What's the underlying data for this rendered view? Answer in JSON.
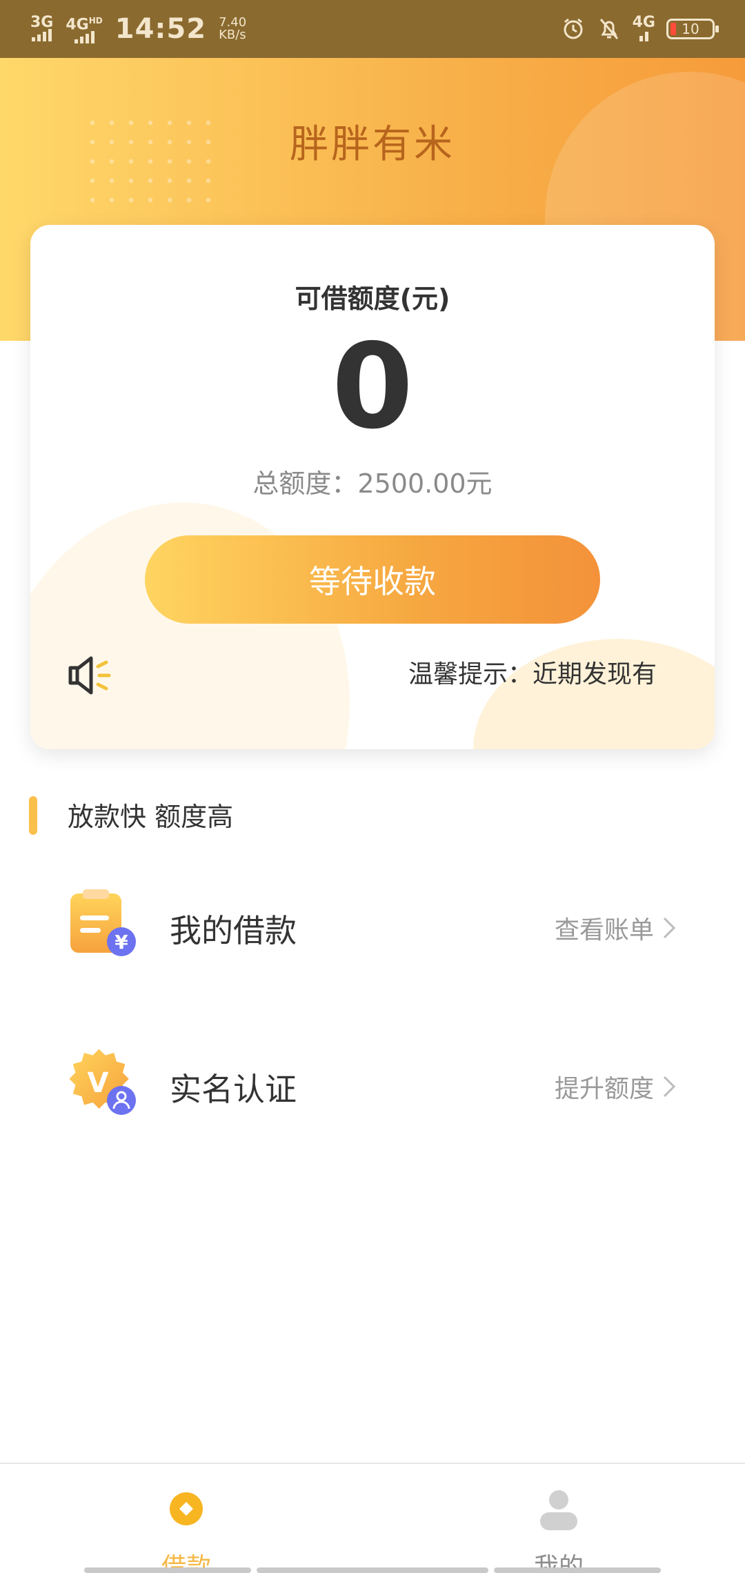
{
  "status_bar": {
    "net1": "3G",
    "net2": "4G",
    "net2_badge": "HD",
    "time": "14:52",
    "speed_value": "7.40",
    "speed_unit": "KB/s",
    "net_right": "4G",
    "battery": "10"
  },
  "header": {
    "title": "胖胖有米"
  },
  "card": {
    "label": "可借额度(元)",
    "amount": "0",
    "total": "总额度：2500.00元",
    "button_label": "等待收款",
    "notice": "温馨提示：近期发现有"
  },
  "section": {
    "title": "放款快 额度高"
  },
  "list": [
    {
      "title": "我的借款",
      "action": "查看账单"
    },
    {
      "title": "实名认证",
      "action": "提升额度"
    }
  ],
  "bottom_nav": [
    {
      "label": "借款",
      "active": true
    },
    {
      "label": "我的",
      "active": false
    }
  ],
  "colors": {
    "accent": "#f5b845",
    "header_start": "#ffd86a",
    "header_end": "#f69b3a",
    "title_brown": "#b7651d"
  }
}
